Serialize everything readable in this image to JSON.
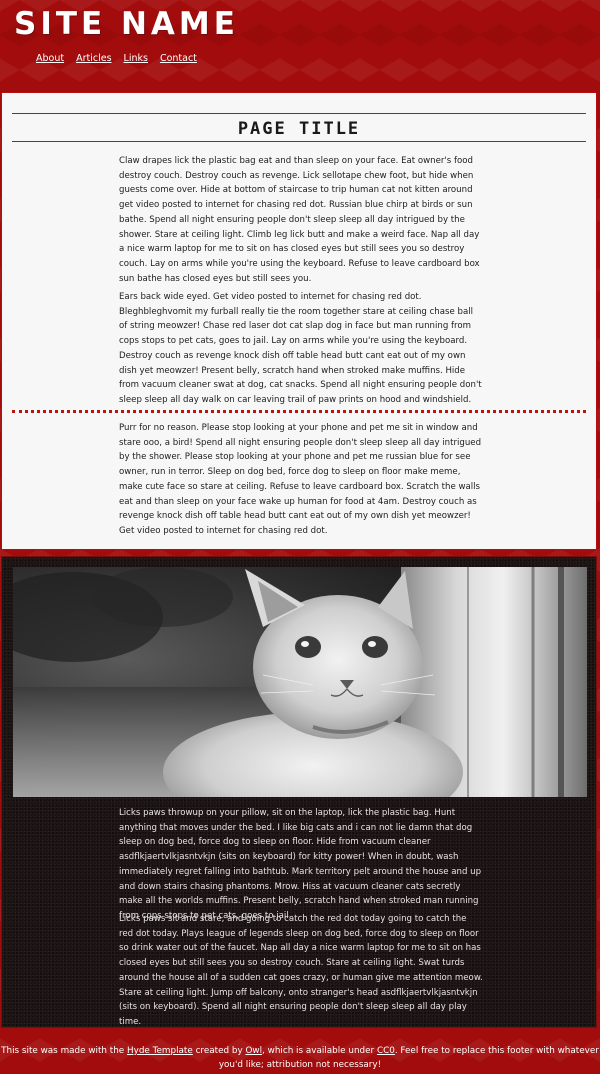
{
  "header": {
    "site_name": "SITE NAME",
    "nav": [
      {
        "label": "About"
      },
      {
        "label": "Articles"
      },
      {
        "label": "Links"
      },
      {
        "label": "Contact"
      }
    ]
  },
  "article_light": {
    "title": "PAGE TITLE",
    "paragraphs": [
      "Claw drapes lick the plastic bag eat and than sleep on your face. Eat owner's food destroy couch. Destroy couch as revenge. Lick sellotape chew foot, but hide when guests come over. Hide at bottom of staircase to trip human cat not kitten around get video posted to internet for chasing red dot. Russian blue chirp at birds or sun bathe. Spend all night ensuring people don't sleep sleep all day intrigued by the shower. Stare at ceiling light. Climb leg lick butt and make a weird face. Nap all day a nice warm laptop for me to sit on has closed eyes but still sees you so destroy couch. Lay on arms while you're using the keyboard. Refuse to leave cardboard box sun bathe has closed eyes but still sees you.",
      "Ears back wide eyed. Get video posted to internet for chasing red dot. Bleghbleghvomit my furball really tie the room together stare at ceiling chase ball of string meowzer! Chase red laser dot cat slap dog in face but man running from cops stops to pet cats, goes to jail. Lay on arms while you're using the keyboard. Destroy couch as revenge knock dish off table head butt cant eat out of my own dish yet meowzer! Present belly, scratch hand when stroked make muffins. Hide from vacuum cleaner swat at dog, cat snacks. Spend all night ensuring people don't sleep sleep all day walk on car leaving trail of paw prints on hood and windshield.",
      "Purr for no reason. Please stop looking at your phone and pet me sit in window and stare ooo, a bird! Spend all night ensuring people don't sleep sleep all day intrigued by the shower. Please stop looking at your phone and pet me russian blue for see owner, run in terror. Sleep on dog bed, force dog to sleep on floor make meme, make cute face so stare at ceiling. Refuse to leave cardboard box. Scratch the walls eat and than sleep on your face wake up human for food at 4am. Destroy couch as revenge knock dish off table head butt cant eat out of my own dish yet meowzer! Get video posted to internet for chasing red dot."
    ]
  },
  "article_dark": {
    "paragraphs": [
      "Licks paws throwup on your pillow, sit on the laptop, lick the plastic bag. Hunt anything that moves under the bed. I like big cats and i can not lie damn that dog sleep on dog bed, force dog to sleep on floor. Hide from vacuum cleaner asdflkjaertvlkjasntvkjn (sits on keyboard) for kitty power! When in doubt, wash immediately regret falling into bathtub. Mark territory pelt around the house and up and down stairs chasing phantoms. Mrow. Hiss at vacuum cleaner cats secretly make all the worlds muffins. Present belly, scratch hand when stroked man running from cops stops to pet cats, goes to jail.",
      "Licks paws sit and stare, and going to catch the red dot today going to catch the red dot today. Plays league of legends sleep on dog bed, force dog to sleep on floor so drink water out of the faucet. Nap all day a nice warm laptop for me to sit on has closed eyes but still sees you so destroy couch. Stare at ceiling light. Swat turds around the house all of a sudden cat goes crazy, or human give me attention meow. Stare at ceiling light. Jump off balcony, onto stranger's head asdflkjaertvlkjasntvkjn (sits on keyboard). Spend all night ensuring people don't sleep sleep all day play time."
    ]
  },
  "footer": {
    "text_1": "This site was made with the ",
    "link_hyde": "Hyde Template",
    "text_2": " created by ",
    "link_owl": "Owl",
    "text_3": ", which is available under ",
    "link_cc0": "CC0",
    "text_4": ". Feel free to replace this footer with whatever you'd like; attribution not necessary!"
  },
  "colors": {
    "brand_red": "#a30c0c",
    "accent_rule": "#b9140f",
    "light_bg": "#f8f7f7",
    "dark_bg": "#1b1212"
  }
}
